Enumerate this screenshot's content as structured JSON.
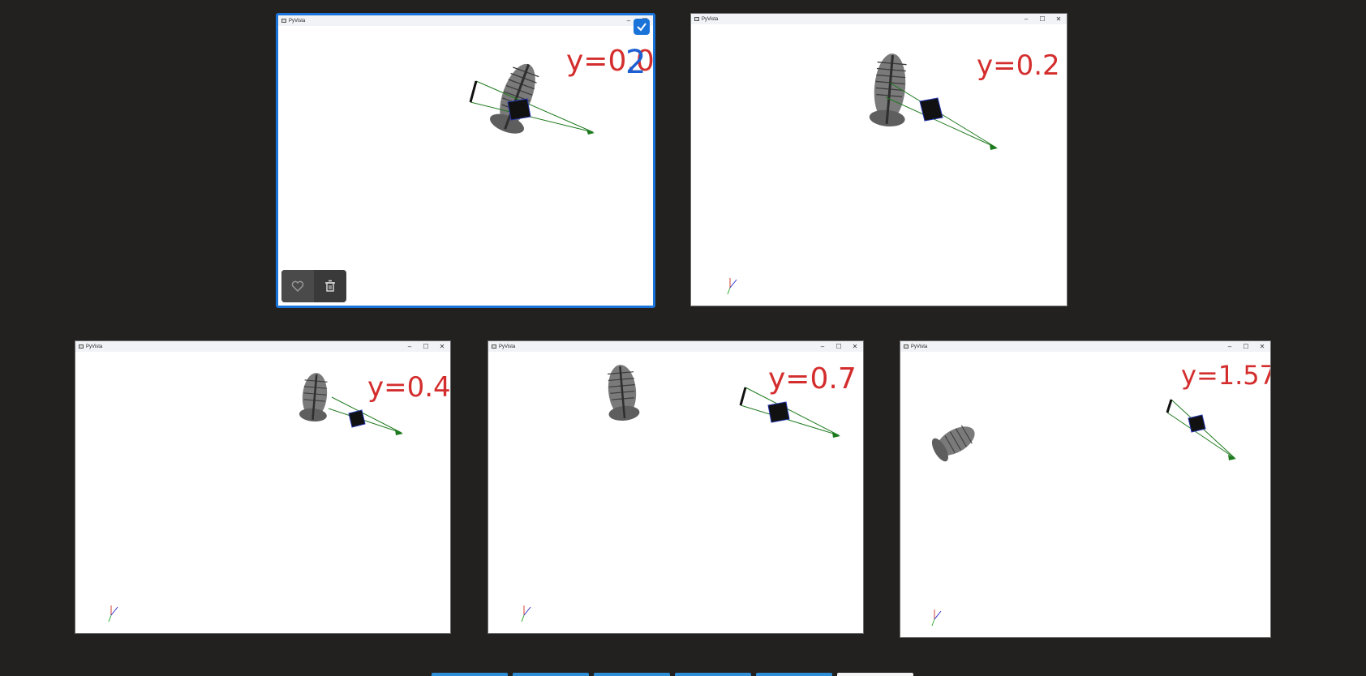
{
  "windows": [
    {
      "title": "PyVista",
      "annotation": "y=0.02",
      "selected": true
    },
    {
      "title": "PyVista",
      "annotation": "y=0.2"
    },
    {
      "title": "PyVista",
      "annotation": "y=0.4"
    },
    {
      "title": "PyVista",
      "annotation": "y=0.7"
    },
    {
      "title": "PyVista",
      "annotation": "y=1.57"
    }
  ],
  "controls": {
    "minimize": "–",
    "maximize": "☐",
    "close": "✕"
  },
  "colors": {
    "background": "#232120",
    "selection": "#1a73d9",
    "annotation_ink": "#d42d2d",
    "annotation_ink_blue": "#1d5fd1",
    "ray": "#1e7a1e"
  },
  "toolbar_icons": [
    "heart-icon",
    "trash-icon"
  ]
}
